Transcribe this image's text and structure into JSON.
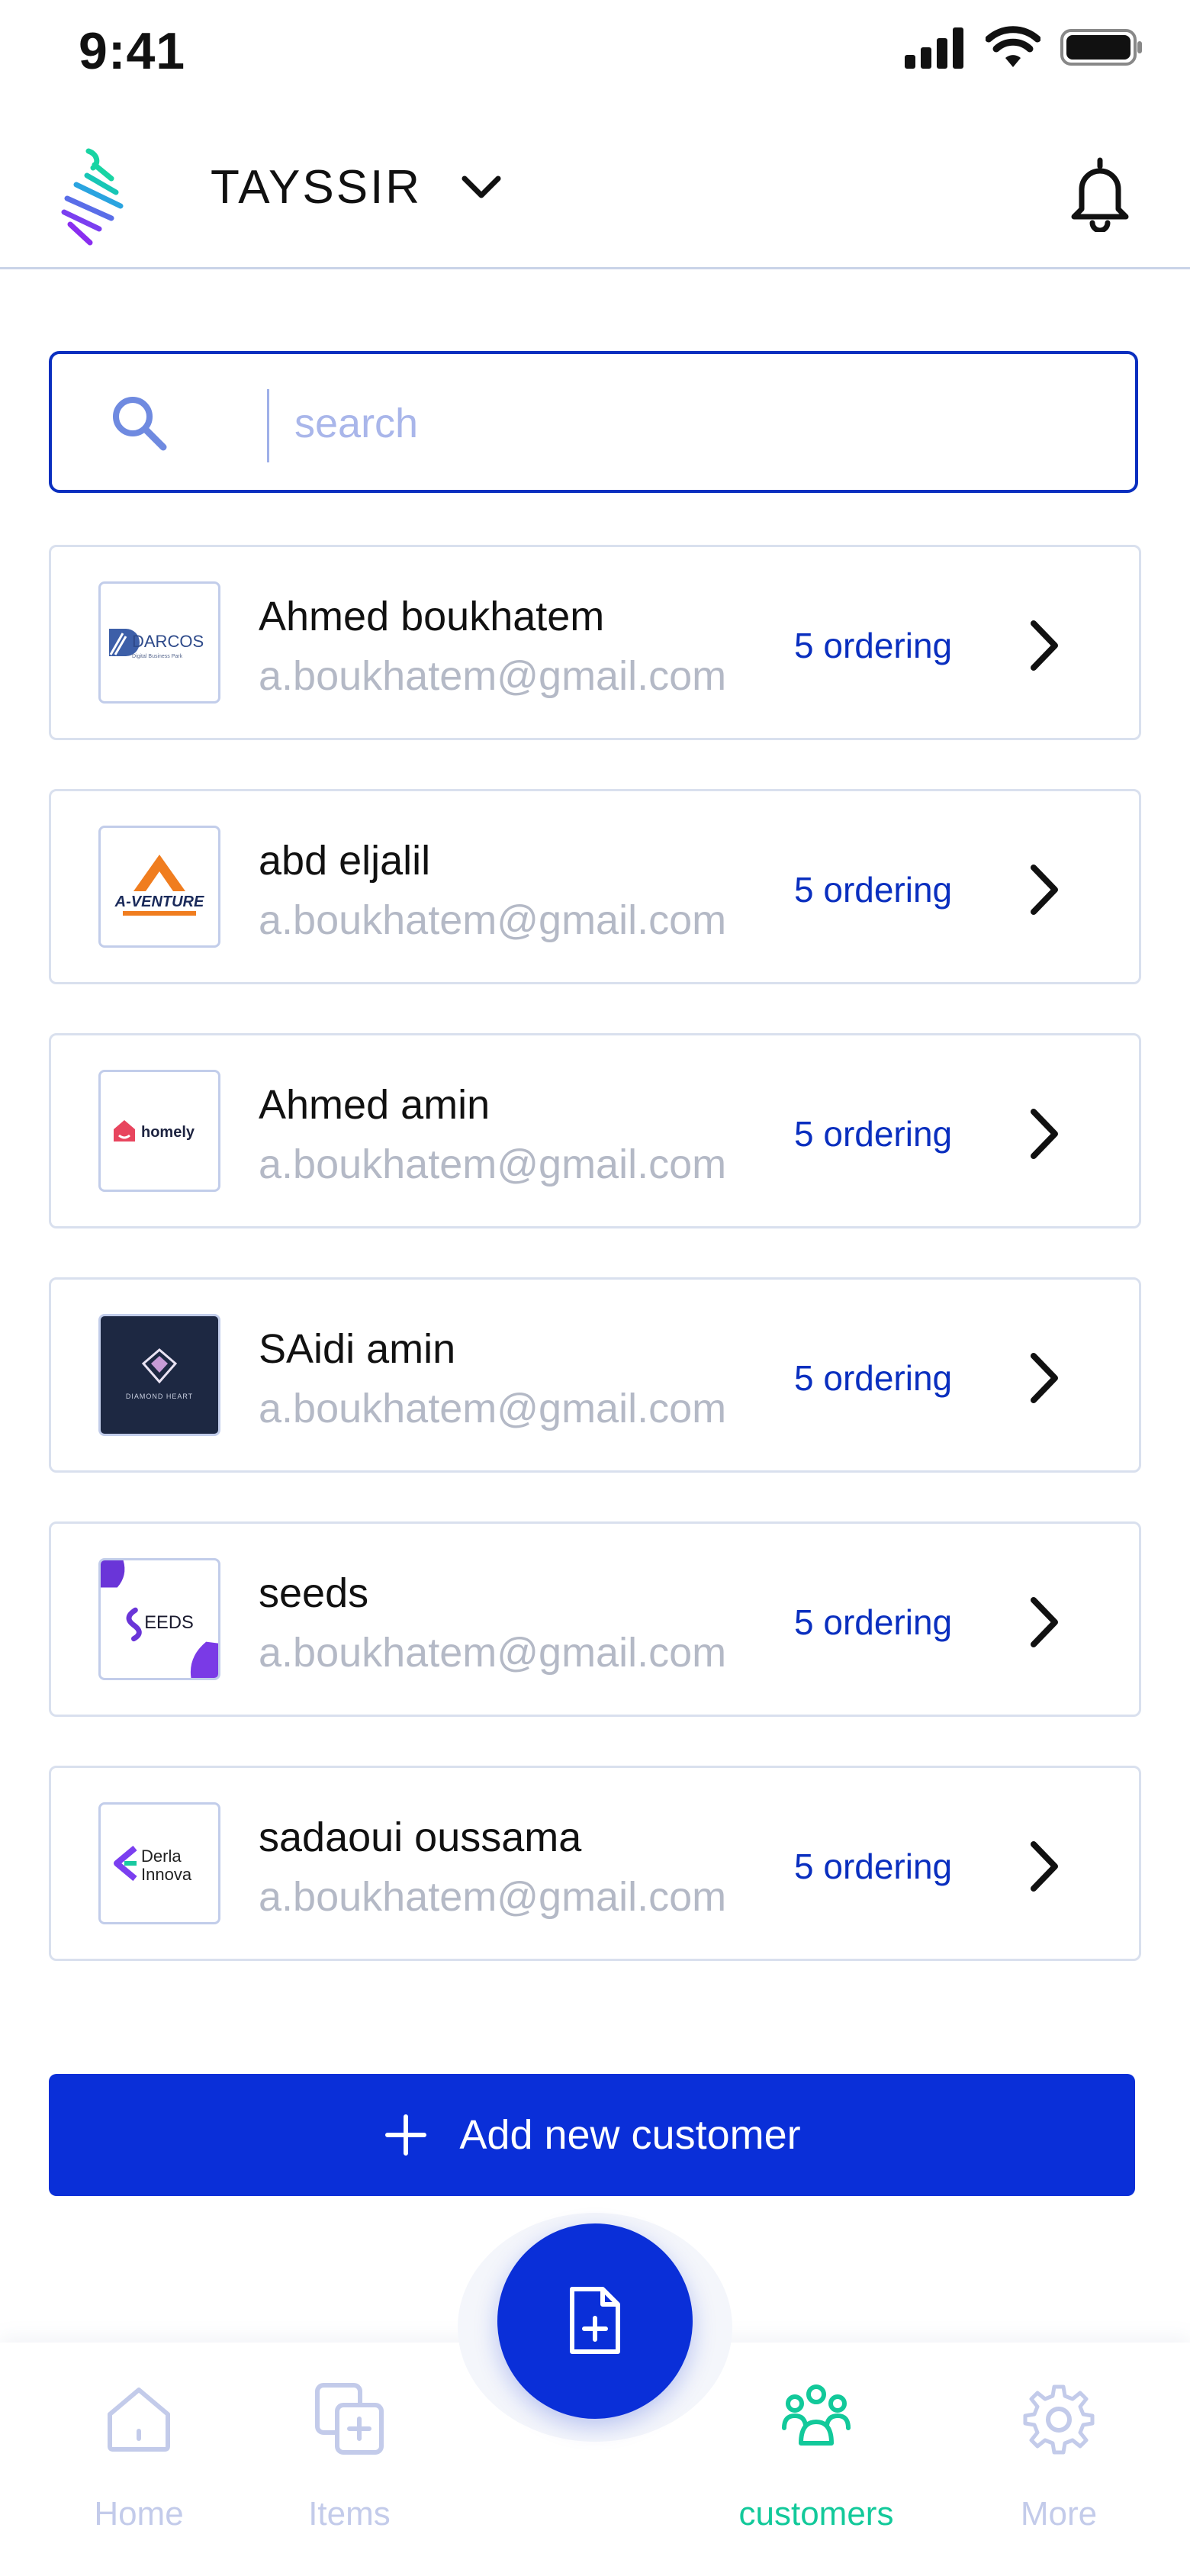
{
  "status_bar": {
    "time": "9:41"
  },
  "header": {
    "workspace_name": "TAYSSIR"
  },
  "search": {
    "placeholder": "search",
    "value": ""
  },
  "customers": [
    {
      "name": "Ahmed boukhatem",
      "email": "a.boukhatem@gmail.com",
      "orders": "5 ordering",
      "logo_text": "DARCOS",
      "logo_subtext": "Digital Business Park"
    },
    {
      "name": "abd eljalil",
      "email": "a.boukhatem@gmail.com",
      "orders": "5 ordering",
      "logo_text": "A-VENTURE"
    },
    {
      "name": "Ahmed amin",
      "email": "a.boukhatem@gmail.com",
      "orders": "5 ordering",
      "logo_text": "homely"
    },
    {
      "name": "SAidi amin",
      "email": "a.boukhatem@gmail.com",
      "orders": "5 ordering",
      "logo_text": "DIAMOND HEART"
    },
    {
      "name": "seeds",
      "email": "a.boukhatem@gmail.com",
      "orders": "5 ordering",
      "logo_text": "EEDS"
    },
    {
      "name": "sadaoui oussama",
      "email": "a.boukhatem@gmail.com",
      "orders": "5 ordering",
      "logo_text": "Derla",
      "logo_subtext": "Innova"
    }
  ],
  "add_button": {
    "label": "Add new customer"
  },
  "bottom_nav": {
    "items": [
      {
        "label": "Home",
        "icon": "home-icon"
      },
      {
        "label": "Items",
        "icon": "items-icon"
      },
      {
        "label": "customers",
        "icon": "customers-icon",
        "active": true
      },
      {
        "label": "More",
        "icon": "gear-icon"
      }
    ],
    "fab_icon": "new-document-icon"
  },
  "colors": {
    "primary": "#0a2fd8",
    "accent_green": "#12c99a",
    "muted": "#c3cbea",
    "email_gray": "#b4b9c6"
  }
}
